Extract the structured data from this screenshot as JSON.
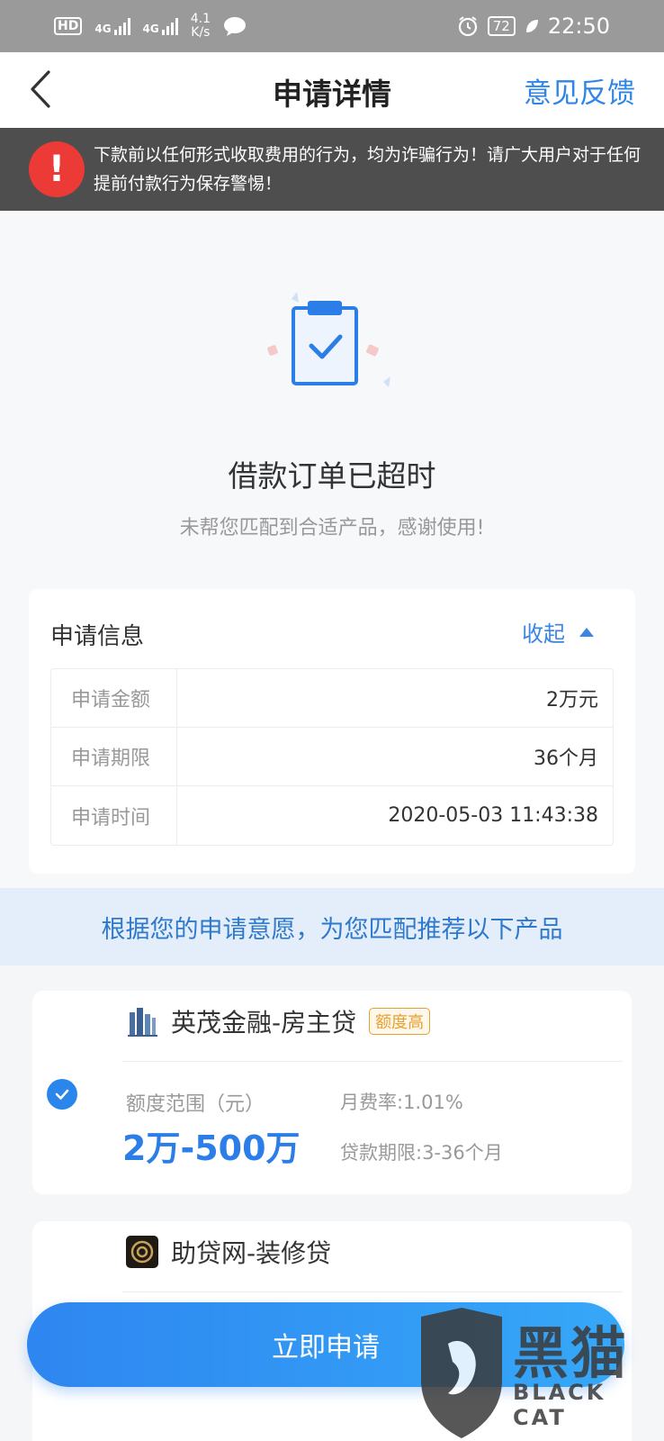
{
  "status_bar": {
    "hd": "HD",
    "net1": "4G",
    "net2": "4G",
    "speed_value": "4.1",
    "speed_unit": "K/s",
    "battery": "72",
    "time": "22:50"
  },
  "nav": {
    "title": "申请详情",
    "feedback": "意见反馈"
  },
  "warning": {
    "icon": "!",
    "text": "下款前以任何形式收取费用的行为，均为诈骗行为！请广大用户对于任何提前付款行为保存警惕！"
  },
  "status": {
    "title": "借款订单已超时",
    "subtitle": "未帮您匹配到合适产品，感谢使用!"
  },
  "info": {
    "title": "申请信息",
    "toggle": "收起",
    "rows": [
      {
        "label": "申请金额",
        "value": "2万元"
      },
      {
        "label": "申请期限",
        "value": "36个月"
      },
      {
        "label": "申请时间",
        "value": "2020-05-03 11:43:38"
      }
    ]
  },
  "recommend": {
    "banner": "根据您的申请意愿，为您匹配推荐以下产品"
  },
  "products": [
    {
      "name": "英茂金融-房主贷",
      "tag": "额度高",
      "range_label": "额度范围（元）",
      "range_value": "2万-500万",
      "rate": "月费率:1.01%",
      "term": "贷款期限:3-36个月",
      "selected": true
    },
    {
      "name": "助贷网-装修贷"
    }
  ],
  "apply_button": "立即申请",
  "watermark": {
    "title": "黑猫",
    "subtitle": "BLACK CAT"
  },
  "colors": {
    "accent": "#2f86e8",
    "warning_red": "#ec3b36",
    "tag_orange": "#e6a133"
  }
}
